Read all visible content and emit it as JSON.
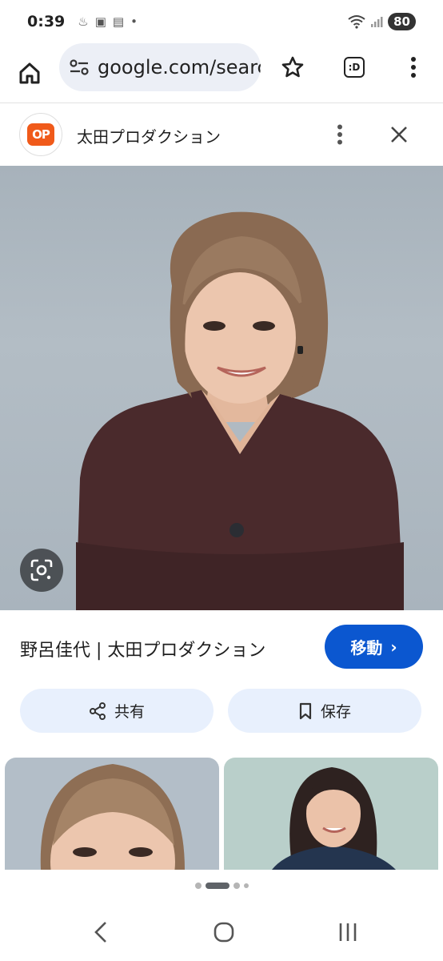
{
  "status": {
    "time": "0:39",
    "battery": "80"
  },
  "toolbar": {
    "url": "google.com/search",
    "tab_count": ":D"
  },
  "site": {
    "name": "太田プロダクション",
    "logo_text": "OP"
  },
  "result": {
    "title": "野呂佳代 | 太田プロダクション",
    "visit_label": "移動",
    "visit_chevron": "›"
  },
  "actions": {
    "share_label": "共有",
    "save_label": "保存"
  },
  "colors": {
    "accent": "#0b57d0",
    "pill_bg": "#e8f0fd",
    "logo": "#f05a1a",
    "sweater": "#4a2a2c"
  },
  "pager": {
    "count": 5,
    "active": 1
  }
}
